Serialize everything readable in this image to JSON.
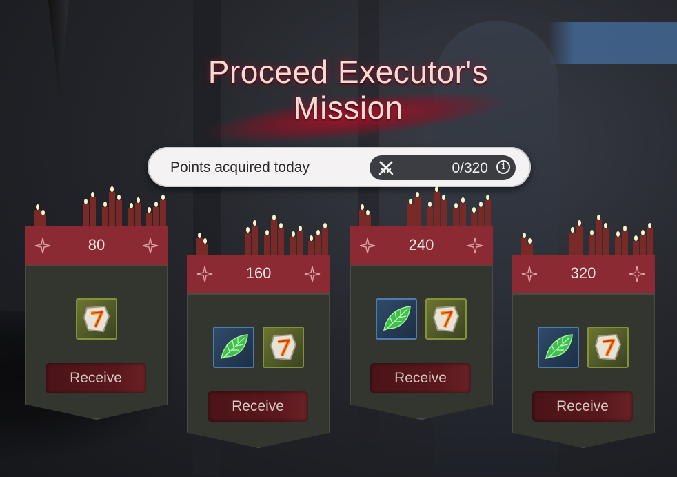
{
  "title": {
    "line1": "Proceed Executor's",
    "line2": "Mission"
  },
  "points": {
    "label": "Points acquired today",
    "value": "0/320",
    "current": 0,
    "max": 320
  },
  "rewards": [
    {
      "points": "80",
      "items": [
        "rune-stone-icon"
      ],
      "button": "Receive"
    },
    {
      "points": "160",
      "items": [
        "green-leaf-icon",
        "rune-stone-icon"
      ],
      "button": "Receive"
    },
    {
      "points": "240",
      "items": [
        "green-leaf-icon",
        "rune-stone-icon"
      ],
      "button": "Receive"
    },
    {
      "points": "320",
      "items": [
        "green-leaf-icon",
        "rune-stone-icon"
      ],
      "button": "Receive"
    }
  ],
  "colors": {
    "banner": "#8c2a33",
    "card": "#33362f",
    "button": "#5a181d",
    "title_glow": "#a01428"
  }
}
